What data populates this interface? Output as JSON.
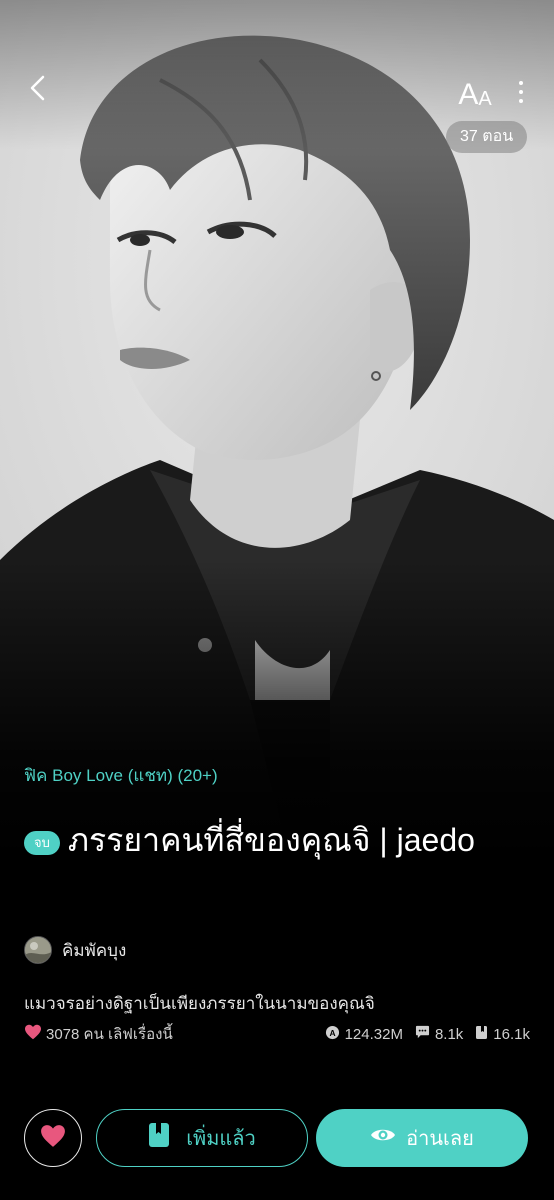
{
  "header": {
    "back_icon": "chevron-left-icon",
    "font_size_label_big": "A",
    "font_size_label_small": "A",
    "more_icon": "more-vertical-icon",
    "episode_count": "37 ตอน"
  },
  "cover": {
    "alt_subject": "black and white portrait of a young man in a leather jacket"
  },
  "story": {
    "category": "ฟิค Boy Love (แชท) (20+)",
    "status_tag": "จบ",
    "title": "ภรรยาคนที่สี่ของคุณจิ | jaedo",
    "author": "คิมพัคบุง",
    "synopsis": "แมวจรอย่างดิฐาเป็นเพียงภรรยาในนามของคุณจิ"
  },
  "stats": {
    "likes_text": "3078 คน เลิฟเรื่องนี้",
    "views": "124.32M",
    "comments": "8.1k",
    "bookmarks": "16.1k"
  },
  "actions": {
    "fav_icon": "heart-icon",
    "added_label": "เพิ่มแล้ว",
    "read_label": "อ่านเลย"
  },
  "colors": {
    "accent": "#4fd1c5",
    "heart": "#e8577e",
    "background": "#000000"
  }
}
